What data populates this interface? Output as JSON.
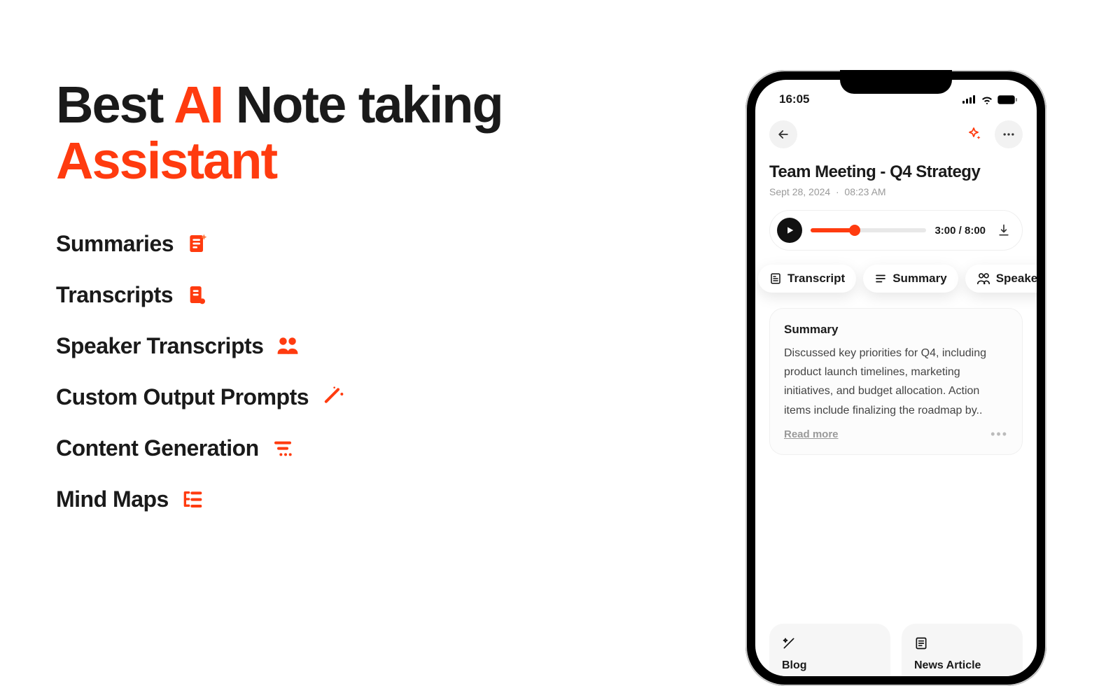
{
  "headline": {
    "part1": "Best ",
    "accent1": "AI",
    "part2": " Note taking",
    "line2": "Assistant"
  },
  "features": [
    {
      "label": "Summaries"
    },
    {
      "label": "Transcripts"
    },
    {
      "label": "Speaker Transcripts"
    },
    {
      "label": "Custom Output Prompts"
    },
    {
      "label": "Content Generation"
    },
    {
      "label": "Mind Maps"
    }
  ],
  "phone": {
    "status_time": "16:05",
    "note_title": "Team Meeting - Q4 Strategy",
    "note_date": "Sept 28, 2024",
    "note_time": "08:23 AM",
    "player": {
      "time": "3:00 / 8:00"
    },
    "chips": {
      "transcript": "Transcript",
      "summary": "Summary",
      "speakers": "Speaker Distinction"
    },
    "summary": {
      "heading": "Summary",
      "body": "Discussed key priorities for Q4, including product launch timelines, marketing initiatives, and budget allocation. Action items include finalizing the roadmap by..",
      "read_more": "Read more"
    },
    "bottom": {
      "blog": "Blog",
      "news": "News Article"
    }
  }
}
